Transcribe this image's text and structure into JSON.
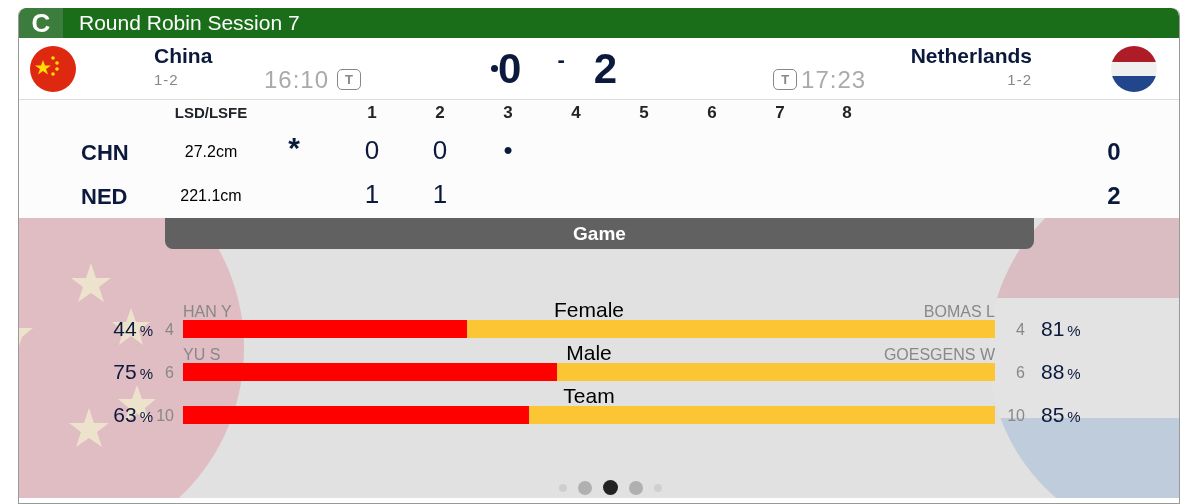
{
  "header": {
    "badge": "C",
    "title": "Round Robin Session 7"
  },
  "teams": [
    {
      "name": "China",
      "record": "1-2",
      "time": "16:10",
      "timer_badge": "T",
      "hammer": true,
      "score": "0"
    },
    {
      "name": "Netherlands",
      "record": "1-2",
      "time": "17:23",
      "timer_badge": "T",
      "hammer": false,
      "score": "2"
    }
  ],
  "score_separator": "-",
  "ends": {
    "lsd_heading": "LSD/LSFE",
    "end_numbers": [
      "1",
      "2",
      "3",
      "4",
      "5",
      "6",
      "7",
      "8"
    ],
    "rows": [
      {
        "code": "CHN",
        "lsd": "27.2cm",
        "marker": "*",
        "ends": [
          "0",
          "0",
          "•"
        ],
        "total": "0"
      },
      {
        "code": "NED",
        "lsd": "221.1cm",
        "ends": [
          "1",
          "1"
        ],
        "total": "2"
      }
    ]
  },
  "section_tab": "Game",
  "stats": [
    {
      "category": "Female",
      "left": {
        "player": "HAN Y",
        "count": "4",
        "pct": "44",
        "pct_sign": "%"
      },
      "right": {
        "player": "BOMAS L",
        "count": "4",
        "pct": "81",
        "pct_sign": "%"
      },
      "level": 0.35
    },
    {
      "category": "Male",
      "left": {
        "player": "YU S",
        "count": "6",
        "pct": "75",
        "pct_sign": "%"
      },
      "right": {
        "player": "GOESGENS W",
        "count": "6",
        "pct": "88",
        "pct_sign": "%"
      },
      "level": 0.46
    },
    {
      "category": "Team",
      "left": {
        "count": "10",
        "pct": "63",
        "pct_sign": "%"
      },
      "right": {
        "count": "10",
        "pct": "85",
        "pct_sign": "%"
      },
      "level": 0.426
    }
  ],
  "pager": [
    {
      "selected": false
    },
    {
      "selected": false
    },
    {
      "selected": true
    },
    {
      "selected": false
    },
    {
      "selected": false
    }
  ]
}
